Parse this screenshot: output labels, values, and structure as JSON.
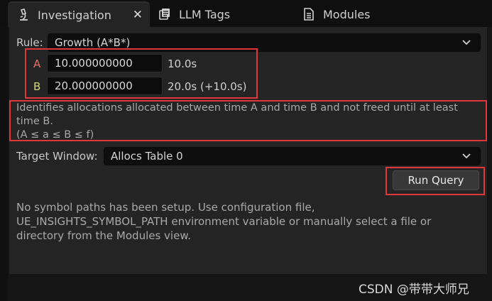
{
  "tabs": {
    "investigation": {
      "label": "Investigation",
      "close": "✕"
    },
    "llm_tags": {
      "label": "LLM Tags"
    },
    "modules": {
      "label": "Modules"
    }
  },
  "rule": {
    "label": "Rule:",
    "value": "Growth (A*B*)"
  },
  "time_a": {
    "letter": "A",
    "value": "10.000000000",
    "display": "10.0s",
    "color": "#e8706a"
  },
  "time_b": {
    "letter": "B",
    "value": "20.000000000",
    "display": "20.0s (+10.0s)",
    "color": "#d8d870"
  },
  "description": {
    "line1": "Identifies allocations allocated between time A and time B and not freed until at least",
    "line2": "time B.",
    "line3": "(A ≤ a ≤ B ≤ f)"
  },
  "target_window": {
    "label": "Target Window:",
    "value": "Allocs Table 0"
  },
  "run_query": {
    "label": "Run Query"
  },
  "info": {
    "line1": "No symbol paths has been setup. Use configuration file,",
    "line2": "UE_INSIGHTS_SYMBOL_PATH environment variable or manually select a file or",
    "line3": "directory from the Modules view."
  },
  "watermark": "CSDN @带带大师兄",
  "colors": {
    "highlight": "#e0383a",
    "panel": "#242424",
    "input_bg": "#0c0c0c"
  }
}
